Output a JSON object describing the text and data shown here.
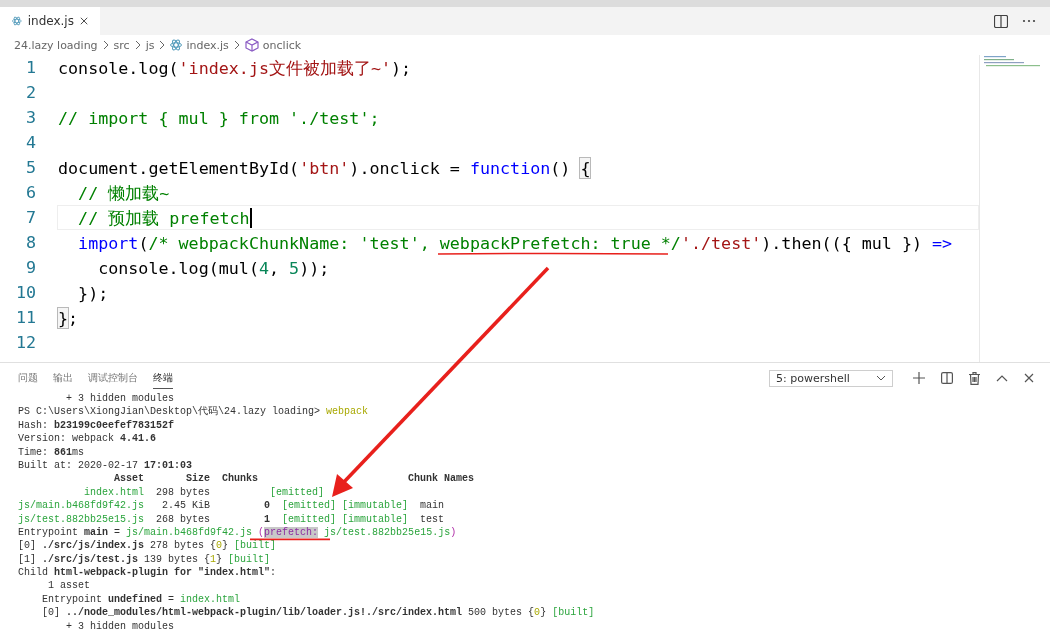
{
  "editor_tabs": [
    {
      "label": "index.js",
      "selected": true
    }
  ],
  "breadcrumb": [
    {
      "label": "24.lazy loading",
      "kind": "folder"
    },
    {
      "label": "src",
      "kind": "folder"
    },
    {
      "label": "js",
      "kind": "folder"
    },
    {
      "label": "index.js",
      "kind": "file"
    },
    {
      "label": "onclick",
      "kind": "method"
    }
  ],
  "code_lines": [
    {
      "number": "1",
      "active": false,
      "tokens": [
        {
          "kind": "plain",
          "text": "console.log("
        },
        {
          "kind": "string",
          "text": "'index.js文件被加载了~'"
        },
        {
          "kind": "plain",
          "text": ");"
        }
      ]
    },
    {
      "number": "2",
      "active": false
    },
    {
      "number": "3",
      "active": false,
      "tokens": [
        {
          "kind": "comment",
          "text": "// import { mul } from './test';"
        }
      ]
    },
    {
      "number": "4",
      "active": false
    },
    {
      "number": "5",
      "active": false,
      "tokens": [
        {
          "kind": "plain",
          "text": "document.getElementById("
        },
        {
          "kind": "string",
          "text": "'btn'"
        },
        {
          "kind": "plain",
          "text": ").onclick = "
        },
        {
          "kind": "keyword",
          "text": "function"
        },
        {
          "kind": "plain",
          "text": "() "
        },
        {
          "kind": "bracket",
          "text": "{"
        }
      ]
    },
    {
      "number": "6",
      "active": false,
      "tokens": [
        {
          "kind": "comment",
          "text": "  // 懒加载~"
        }
      ]
    },
    {
      "number": "7",
      "active": true,
      "tokens": [
        {
          "kind": "comment",
          "text": "  // 预加载 prefetch"
        }
      ]
    },
    {
      "number": "8",
      "active": false,
      "tokens": [
        {
          "kind": "keyword",
          "text": "  import"
        },
        {
          "kind": "plain",
          "text": "("
        },
        {
          "kind": "comment",
          "text": "/* webpackChunkName: 'test', webpackPrefetch: true */"
        },
        {
          "kind": "string",
          "text": "'./test'"
        },
        {
          "kind": "plain",
          "text": ").then(({ mul }) "
        },
        {
          "kind": "keyword",
          "text": "=>"
        }
      ]
    },
    {
      "number": "9",
      "active": false,
      "tokens": [
        {
          "kind": "plain",
          "text": "    console.log(mul("
        },
        {
          "kind": "number",
          "text": "4"
        },
        {
          "kind": "plain",
          "text": ", "
        },
        {
          "kind": "number",
          "text": "5"
        },
        {
          "kind": "plain",
          "text": "));"
        }
      ]
    },
    {
      "number": "10",
      "active": false,
      "tokens": [
        {
          "kind": "plain",
          "text": "  });"
        }
      ]
    },
    {
      "number": "11",
      "active": false,
      "tokens": [
        {
          "kind": "bracket",
          "text": "}"
        },
        {
          "kind": "plain",
          "text": ";"
        }
      ]
    },
    {
      "number": "12",
      "active": false
    }
  ],
  "panel": {
    "tabs": [
      {
        "label": "问题",
        "selected": false
      },
      {
        "label": "输出",
        "selected": false
      },
      {
        "label": "调试控制台",
        "selected": false
      },
      {
        "label": "终端",
        "selected": true
      }
    ],
    "terminal_select": "5: powershell",
    "terminal_lines": [
      {
        "segments": [
          {
            "kind": "plain",
            "text": "        + 3 hidden modules"
          }
        ]
      },
      {
        "segments": [
          {
            "kind": "plain",
            "text": "PS C:\\Users\\XiongJian\\Desktop\\代码\\24.lazy loading> "
          },
          {
            "kind": "yellow",
            "text": "webpack"
          }
        ]
      },
      {
        "segments": [
          {
            "kind": "plain",
            "text": "Hash: "
          },
          {
            "kind": "bold",
            "text": "b23199c0eefef783152f"
          }
        ]
      },
      {
        "segments": [
          {
            "kind": "plain",
            "text": "Version: webpack "
          },
          {
            "kind": "bold",
            "text": "4.41.6"
          }
        ]
      },
      {
        "segments": [
          {
            "kind": "plain",
            "text": "Time: "
          },
          {
            "kind": "bold",
            "text": "861"
          },
          {
            "kind": "plain",
            "text": "ms"
          }
        ]
      },
      {
        "segments": [
          {
            "kind": "plain",
            "text": "Built at: 2020-02-17 "
          },
          {
            "kind": "bold",
            "text": "17:01:03"
          }
        ]
      },
      {
        "segments": [
          {
            "kind": "bold",
            "text": "                Asset       Size  Chunks                         Chunk Names"
          }
        ]
      },
      {
        "segments": [
          {
            "kind": "green",
            "text": "           index.html"
          },
          {
            "kind": "plain",
            "text": "  298 bytes          "
          },
          {
            "kind": "green",
            "text": "[emitted]"
          }
        ]
      },
      {
        "segments": [
          {
            "kind": "green",
            "text": "js/main.b468fd9f42.js"
          },
          {
            "kind": "plain",
            "text": "   2.45 KiB         "
          },
          {
            "kind": "bold",
            "text": "0"
          },
          {
            "kind": "green",
            "text": "  [emitted]"
          },
          {
            "kind": "green",
            "text": " [immutable]"
          },
          {
            "kind": "plain",
            "text": "  main"
          }
        ]
      },
      {
        "segments": [
          {
            "kind": "green",
            "text": "js/test.882bb25e15.js"
          },
          {
            "kind": "plain",
            "text": "  268 bytes         "
          },
          {
            "kind": "bold",
            "text": "1"
          },
          {
            "kind": "green",
            "text": "  [emitted]"
          },
          {
            "kind": "green",
            "text": " [immutable]"
          },
          {
            "kind": "plain",
            "text": "  test"
          }
        ]
      },
      {
        "segments": [
          {
            "kind": "plain",
            "text": "Entrypoint "
          },
          {
            "kind": "bold",
            "text": "main"
          },
          {
            "kind": "plain",
            "text": " = "
          },
          {
            "kind": "green",
            "text": "js/main.b468fd9f42.js"
          },
          {
            "kind": "purple",
            "text": " ("
          },
          {
            "kind": "highlight",
            "text": "prefetch:"
          },
          {
            "kind": "green",
            "text": " js/test.882bb25e15.js"
          },
          {
            "kind": "purple",
            "text": ")"
          }
        ]
      },
      {
        "segments": [
          {
            "kind": "plain",
            "text": "[0] "
          },
          {
            "kind": "bold",
            "text": "./src/js/index.js"
          },
          {
            "kind": "plain",
            "text": " 278 bytes {"
          },
          {
            "kind": "yellow",
            "text": "0"
          },
          {
            "kind": "plain",
            "text": "} "
          },
          {
            "kind": "green",
            "text": "[built]"
          }
        ]
      },
      {
        "segments": [
          {
            "kind": "plain",
            "text": "[1] "
          },
          {
            "kind": "bold",
            "text": "./src/js/test.js"
          },
          {
            "kind": "plain",
            "text": " 139 bytes {"
          },
          {
            "kind": "yellow",
            "text": "1"
          },
          {
            "kind": "plain",
            "text": "} "
          },
          {
            "kind": "green",
            "text": "[built]"
          }
        ]
      },
      {
        "segments": [
          {
            "kind": "plain",
            "text": "Child "
          },
          {
            "kind": "bold",
            "text": "html-webpack-plugin for \"index.html\""
          },
          {
            "kind": "plain",
            "text": ":"
          }
        ]
      },
      {
        "segments": [
          {
            "kind": "plain",
            "text": "     1 asset"
          }
        ]
      },
      {
        "segments": [
          {
            "kind": "plain",
            "text": "    Entrypoint "
          },
          {
            "kind": "bold",
            "text": "undefined"
          },
          {
            "kind": "plain",
            "text": " = "
          },
          {
            "kind": "green",
            "text": "index.html"
          }
        ]
      },
      {
        "segments": [
          {
            "kind": "plain",
            "text": "    [0] "
          },
          {
            "kind": "bold",
            "text": "../node_modules/html-webpack-plugin/lib/loader.js!./src/index.html"
          },
          {
            "kind": "plain",
            "text": " 500 bytes {"
          },
          {
            "kind": "yellow",
            "text": "0"
          },
          {
            "kind": "plain",
            "text": "} "
          },
          {
            "kind": "green",
            "text": "[built]"
          }
        ]
      },
      {
        "segments": [
          {
            "kind": "plain",
            "text": "        + 3 hidden modules"
          }
        ]
      }
    ]
  }
}
